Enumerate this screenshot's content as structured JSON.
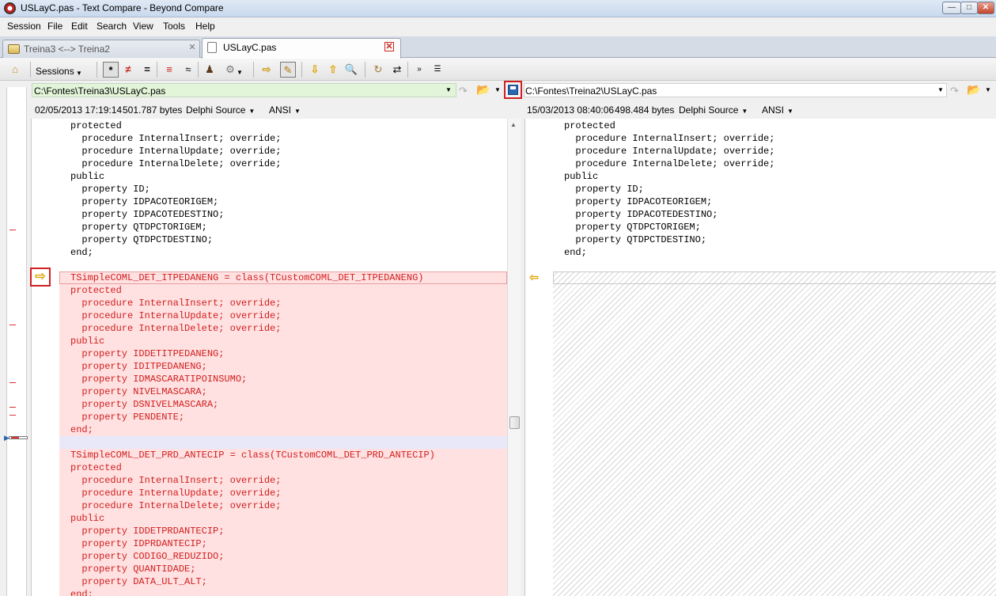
{
  "window": {
    "title": "USLayC.pas - Text Compare - Beyond Compare"
  },
  "menu": [
    "Session",
    "File",
    "Edit",
    "Search",
    "View",
    "Tools",
    "Help"
  ],
  "tabs": [
    {
      "label": "Treina3 <--> Treina2"
    },
    {
      "label": "USLayC.pas"
    }
  ],
  "toolbar": {
    "sessions_label": "Sessions"
  },
  "left": {
    "path": "C:\\Fontes\\Treina3\\USLayC.pas",
    "datetime": "02/05/2013 17:19:14",
    "size": "501.787 bytes",
    "format": "Delphi Source",
    "encoding": "ANSI"
  },
  "right": {
    "path": "C:\\Fontes\\Treina2\\USLayC.pas",
    "datetime": "15/03/2013 08:40:06",
    "size": "498.484 bytes",
    "format": "Delphi Source",
    "encoding": "ANSI"
  },
  "colors": {
    "diff_bg": "#ffe1e1",
    "diff_text": "#d21e1e",
    "marker": "#d02020"
  },
  "left_lines": [
    {
      "text": "protected",
      "kind": "same"
    },
    {
      "text": "  procedure InternalInsert; override;",
      "kind": "same"
    },
    {
      "text": "  procedure InternalUpdate; override;",
      "kind": "same"
    },
    {
      "text": "  procedure InternalDelete; override;",
      "kind": "same"
    },
    {
      "text": "public",
      "kind": "same"
    },
    {
      "text": "  property ID;",
      "kind": "same"
    },
    {
      "text": "  property IDPACOTEORIGEM;",
      "kind": "same"
    },
    {
      "text": "  property IDPACOTEDESTINO;",
      "kind": "same"
    },
    {
      "text": "  property QTDPCTORIGEM;",
      "kind": "same"
    },
    {
      "text": "  property QTDPCTDESTINO;",
      "kind": "same"
    },
    {
      "text": "end;",
      "kind": "same"
    },
    {
      "text": "",
      "kind": "same"
    },
    {
      "text": "TSimpleCOML_DET_ITPEDANENG = class(TCustomCOML_DET_ITPEDANENG)",
      "kind": "diff"
    },
    {
      "text": "protected",
      "kind": "diff"
    },
    {
      "text": "  procedure InternalInsert; override;",
      "kind": "diff"
    },
    {
      "text": "  procedure InternalUpdate; override;",
      "kind": "diff"
    },
    {
      "text": "  procedure InternalDelete; override;",
      "kind": "diff"
    },
    {
      "text": "public",
      "kind": "diff"
    },
    {
      "text": "  property IDDETITPEDANENG;",
      "kind": "diff"
    },
    {
      "text": "  property IDITPEDANENG;",
      "kind": "diff"
    },
    {
      "text": "  property IDMASCARATIPOINSUMO;",
      "kind": "diff"
    },
    {
      "text": "  property NIVELMASCARA;",
      "kind": "diff"
    },
    {
      "text": "  property DSNIVELMASCARA;",
      "kind": "diff"
    },
    {
      "text": "  property PENDENTE;",
      "kind": "diff"
    },
    {
      "text": "end;",
      "kind": "diff"
    },
    {
      "text": "",
      "kind": "blank"
    },
    {
      "text": "TSimpleCOML_DET_PRD_ANTECIP = class(TCustomCOML_DET_PRD_ANTECIP)",
      "kind": "diff"
    },
    {
      "text": "protected",
      "kind": "diff"
    },
    {
      "text": "  procedure InternalInsert; override;",
      "kind": "diff"
    },
    {
      "text": "  procedure InternalUpdate; override;",
      "kind": "diff"
    },
    {
      "text": "  procedure InternalDelete; override;",
      "kind": "diff"
    },
    {
      "text": "public",
      "kind": "diff"
    },
    {
      "text": "  property IDDETPRDANTECIP;",
      "kind": "diff"
    },
    {
      "text": "  property IDPRDANTECIP;",
      "kind": "diff"
    },
    {
      "text": "  property CODIGO_REDUZIDO;",
      "kind": "diff"
    },
    {
      "text": "  property QUANTIDADE;",
      "kind": "diff"
    },
    {
      "text": "  property DATA_ULT_ALT;",
      "kind": "diff"
    },
    {
      "text": "end;",
      "kind": "diff"
    }
  ],
  "right_lines": [
    {
      "text": "protected"
    },
    {
      "text": "  procedure InternalInsert; override;"
    },
    {
      "text": "  procedure InternalUpdate; override;"
    },
    {
      "text": "  procedure InternalDelete; override;"
    },
    {
      "text": "public"
    },
    {
      "text": "  property ID;"
    },
    {
      "text": "  property IDPACOTEORIGEM;"
    },
    {
      "text": "  property IDPACOTEDESTINO;"
    },
    {
      "text": "  property QTDPCTORIGEM;"
    },
    {
      "text": "  property QTDPCTDESTINO;"
    },
    {
      "text": "end;"
    }
  ]
}
